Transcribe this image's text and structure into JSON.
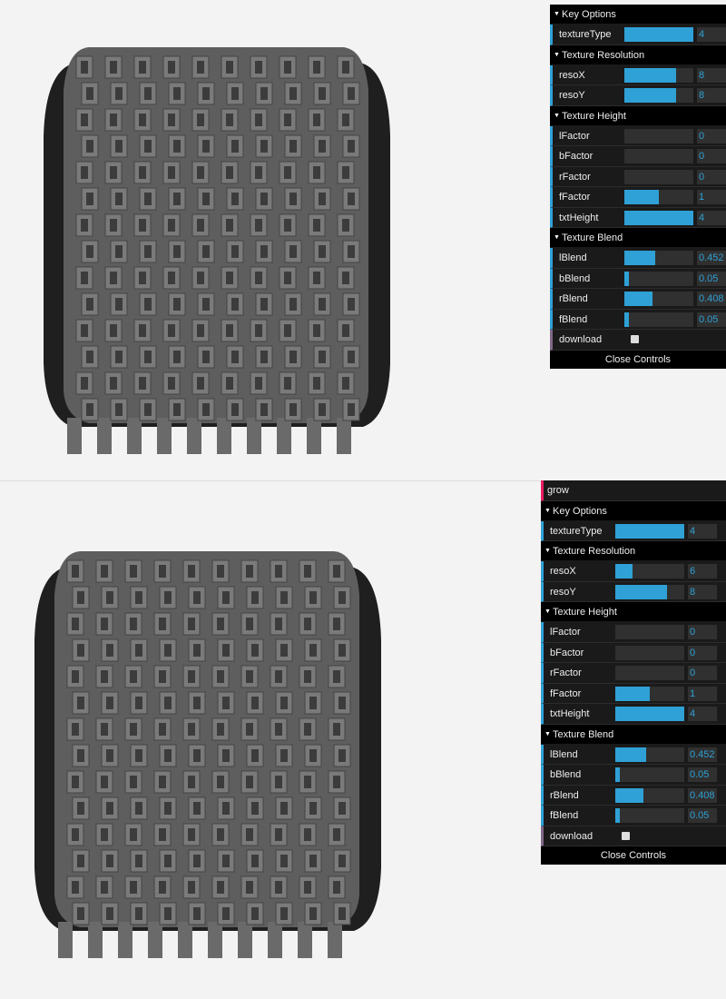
{
  "colors": {
    "accent": "#2fa1d6",
    "panel_bg": "#1a1a1a",
    "canvas_bg": "#f3f3f3",
    "tire_face": "#5f5f5f",
    "tire_side": "#232323"
  },
  "panel_top": {
    "folders": [
      {
        "title": "Key Options",
        "rows": [
          {
            "label": "textureType",
            "value": "4",
            "fill": 1.0
          }
        ]
      },
      {
        "title": "Texture Resolution",
        "rows": [
          {
            "label": "resoX",
            "value": "8",
            "fill": 0.75
          },
          {
            "label": "resoY",
            "value": "8",
            "fill": 0.75
          }
        ]
      },
      {
        "title": "Texture Height",
        "rows": [
          {
            "label": "lFactor",
            "value": "0",
            "fill": 0
          },
          {
            "label": "bFactor",
            "value": "0",
            "fill": 0
          },
          {
            "label": "rFactor",
            "value": "0",
            "fill": 0
          },
          {
            "label": "fFactor",
            "value": "1",
            "fill": 0.5
          },
          {
            "label": "txtHeight",
            "value": "4",
            "fill": 1.0
          }
        ]
      },
      {
        "title": "Texture Blend",
        "rows": [
          {
            "label": "lBlend",
            "value": "0.452",
            "fill": 0.452
          },
          {
            "label": "bBlend",
            "value": "0.05",
            "fill": 0.05
          },
          {
            "label": "rBlend",
            "value": "0.408",
            "fill": 0.408
          },
          {
            "label": "fBlend",
            "value": "0.05",
            "fill": 0.05
          }
        ]
      }
    ],
    "download_label": "download",
    "close_label": "Close Controls"
  },
  "panel_bottom": {
    "string_value": "grow",
    "folders": [
      {
        "title": "Key Options",
        "rows": [
          {
            "label": "textureType",
            "value": "4",
            "fill": 1.0
          }
        ]
      },
      {
        "title": "Texture Resolution",
        "rows": [
          {
            "label": "resoX",
            "value": "6",
            "fill": 0.25
          },
          {
            "label": "resoY",
            "value": "8",
            "fill": 0.75
          }
        ]
      },
      {
        "title": "Texture Height",
        "rows": [
          {
            "label": "lFactor",
            "value": "0",
            "fill": 0
          },
          {
            "label": "bFactor",
            "value": "0",
            "fill": 0
          },
          {
            "label": "rFactor",
            "value": "0",
            "fill": 0
          },
          {
            "label": "fFactor",
            "value": "1",
            "fill": 0.5
          },
          {
            "label": "txtHeight",
            "value": "4",
            "fill": 1.0
          }
        ]
      },
      {
        "title": "Texture Blend",
        "rows": [
          {
            "label": "lBlend",
            "value": "0.452",
            "fill": 0.452
          },
          {
            "label": "bBlend",
            "value": "0.05",
            "fill": 0.05
          },
          {
            "label": "rBlend",
            "value": "0.408",
            "fill": 0.408
          },
          {
            "label": "fBlend",
            "value": "0.05",
            "fill": 0.05
          }
        ]
      }
    ],
    "download_label": "download",
    "close_label": "Close Controls"
  }
}
